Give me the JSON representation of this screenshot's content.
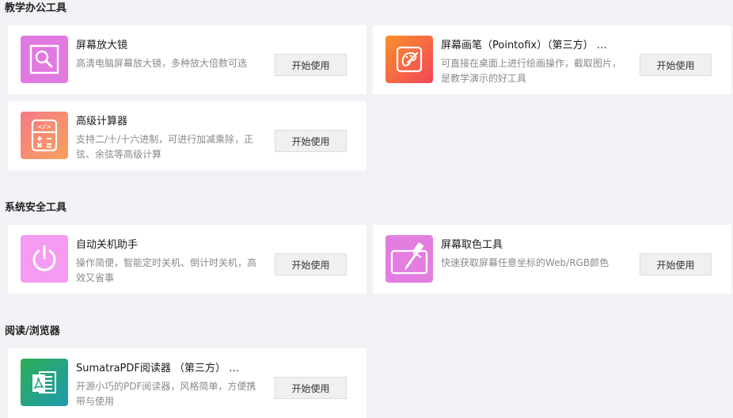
{
  "sections": [
    {
      "title": "教学办公工具",
      "apps": [
        {
          "name": "屏幕放大镜",
          "desc": "高清电脑屏幕放大镜，多种放大倍数可选",
          "button": "开始使用",
          "icon": "magnifier-icon",
          "icon_color": "#e17ae0"
        },
        {
          "name": "屏幕画笔（Pointofix）（第三方） …",
          "desc": "可直接在桌面上进行绘画操作，截取图片，是教学演示的好工具",
          "button": "开始使用",
          "icon": "palette-icon",
          "icon_color": "#f8603f"
        },
        {
          "name": "高级计算器",
          "desc": "支持二/十/十六进制，可进行加减乘除，正弦、余弦等高级计算",
          "button": "开始使用",
          "icon": "calculator-icon",
          "icon_color": "#f58a72"
        }
      ]
    },
    {
      "title": "系统安全工具",
      "apps": [
        {
          "name": "自动关机助手",
          "desc": "操作简便，智能定时关机、倒计时关机，高效又省事",
          "button": "开始使用",
          "icon": "power-icon",
          "icon_color": "#f59cf2"
        },
        {
          "name": "屏幕取色工具",
          "desc": "快速获取屏幕任意坐标的Web/RGB颜色",
          "button": "开始使用",
          "icon": "eyedropper-icon",
          "icon_color": "#e37de0"
        }
      ]
    },
    {
      "title": "阅读/浏览器",
      "apps": [
        {
          "name": "SumatraPDF阅读器 （第三方） …",
          "desc": "开源小巧的PDF阅读器，风格简单，方便携带与使用",
          "button": "开始使用",
          "icon": "pdf-reader-icon",
          "icon_color": "#26a47f"
        }
      ]
    }
  ]
}
